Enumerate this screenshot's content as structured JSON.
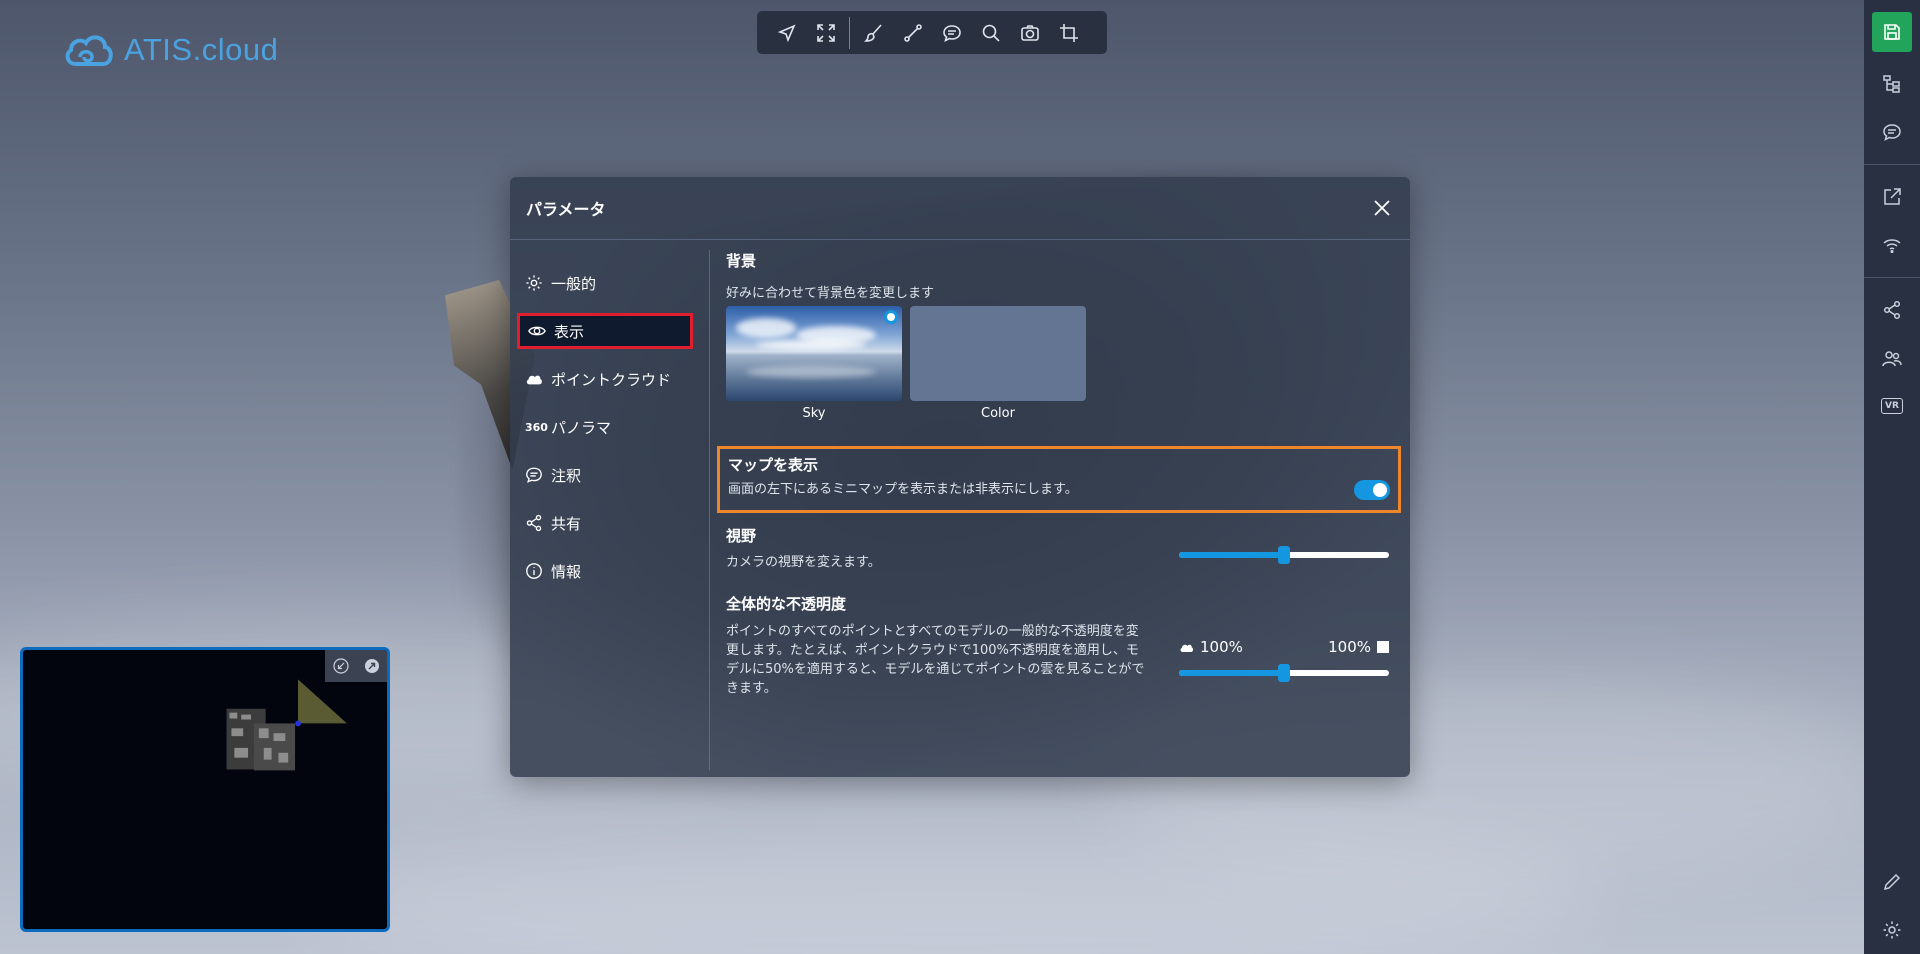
{
  "app": {
    "logo_text": "ATIS.cloud"
  },
  "toolbar": {
    "items": [
      "navigate-icon",
      "fullscreen-icon",
      "brush-icon",
      "measure-icon",
      "comment-icon",
      "search-icon",
      "camera-icon",
      "crop-icon"
    ]
  },
  "dialog": {
    "title": "パラメータ",
    "nav": [
      {
        "label": "一般的",
        "icon": "gear-icon"
      },
      {
        "label": "表示",
        "icon": "eye-icon",
        "active": true
      },
      {
        "label": "ポイントクラウド",
        "icon": "cloud-icon"
      },
      {
        "label": "パノラマ",
        "icon": "360-icon",
        "icon_text": "360"
      },
      {
        "label": "注釈",
        "icon": "annotation-icon"
      },
      {
        "label": "共有",
        "icon": "share-icon"
      },
      {
        "label": "情報",
        "icon": "info-icon"
      }
    ],
    "background": {
      "title": "背景",
      "description": "好みに合わせて背景色を変更します",
      "options": [
        {
          "label": "Sky",
          "selected": true
        },
        {
          "label": "Color",
          "color": "#637592"
        }
      ]
    },
    "map": {
      "title": "マップを表示",
      "description": "画面の左下にあるミニマップを表示または非表示にします。",
      "enabled": true
    },
    "fov": {
      "title": "視野",
      "description": "カメラの視野を変えます。",
      "value_fraction": 0.5
    },
    "opacity": {
      "title": "全体的な不透明度",
      "description": "ポイントのすべてのポイントとすべてのモデルの一般的な不透明度を変更します。たとえば、ポイントクラウドで100%不透明度を適用し、モデルに50%を適用すると、モデルを通じてポイントの雲を見ることができます。",
      "pointcloud_label": "100%",
      "model_label": "100%",
      "value_fraction": 0.5
    }
  },
  "colors": {
    "accent": "#1596e0",
    "save": "#22a55b",
    "active_outline": "#e01e2e",
    "map_outline": "#f0862c"
  }
}
